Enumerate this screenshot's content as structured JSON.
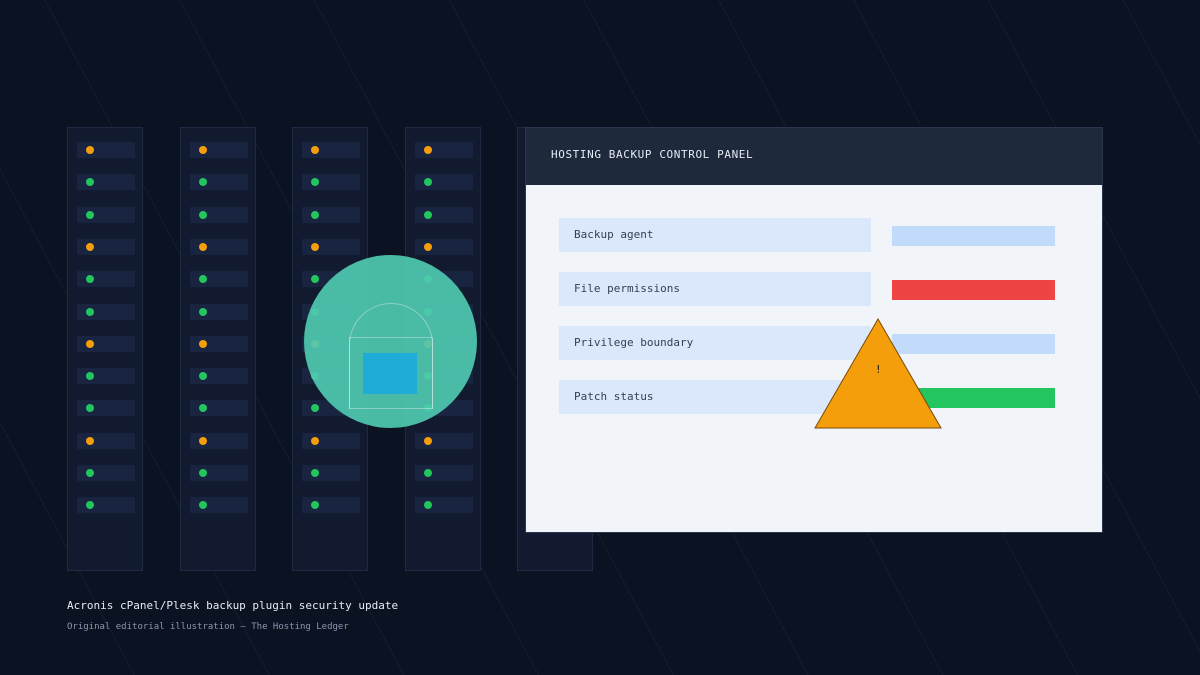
{
  "panel": {
    "title": "HOSTING BACKUP CONTROL PANEL",
    "rows": [
      {
        "label": "Backup agent",
        "status_color": "#c3dbfb"
      },
      {
        "label": "File permissions",
        "status_color": "#ef4444"
      },
      {
        "label": "Privilege boundary",
        "status_color": "#c3dbfb"
      },
      {
        "label": "Patch status",
        "status_color": "#22c55e"
      }
    ]
  },
  "warning": {
    "glyph": "!",
    "icon": "warning-triangle-icon",
    "color": "#f59e0b"
  },
  "shield": {
    "icon": "lock-icon",
    "color": "#4fc9b0"
  },
  "racks": {
    "led_pattern": [
      "orange",
      "green",
      "green",
      "orange",
      "green",
      "green",
      "orange",
      "green",
      "green",
      "orange",
      "green",
      "green"
    ]
  },
  "caption": {
    "title": "Acronis cPanel/Plesk backup plugin security update",
    "credit": "Original editorial illustration — The Hosting Ledger"
  }
}
